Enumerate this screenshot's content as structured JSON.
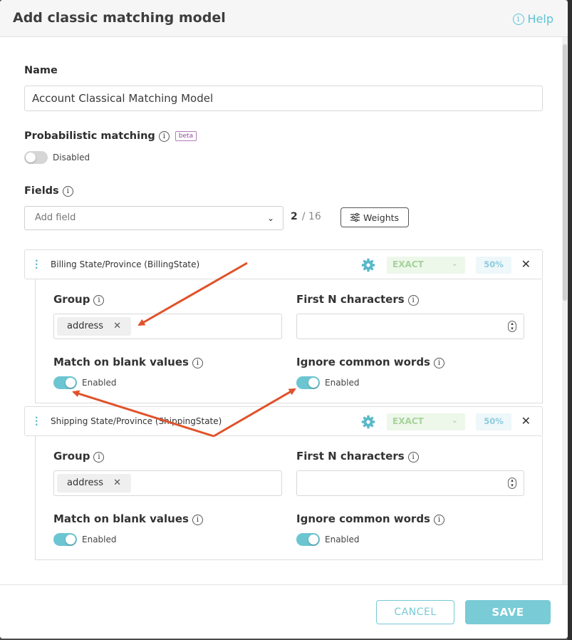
{
  "header": {
    "title": "Add classic matching model",
    "help_label": "Help"
  },
  "name": {
    "label": "Name",
    "value": "Account Classical Matching Model"
  },
  "probabilistic": {
    "label": "Probabilistic matching",
    "badge": "beta",
    "toggle_label": "Disabled",
    "enabled": false
  },
  "fields": {
    "label": "Fields",
    "add_placeholder": "Add field",
    "count": "2",
    "max": "/ 16",
    "weights_label": "Weights",
    "items": [
      {
        "name": "Billing State/Province (BillingState)",
        "match_type": "EXACT",
        "weight": "50%",
        "group_label": "Group",
        "group_chip": "address",
        "first_n_label": "First N characters",
        "blank_label": "Match on blank values",
        "blank_toggle": "Enabled",
        "ignore_label": "Ignore common words",
        "ignore_toggle": "Enabled"
      },
      {
        "name": "Shipping State/Province (ShippingState)",
        "match_type": "EXACT",
        "weight": "50%",
        "group_label": "Group",
        "group_chip": "address",
        "first_n_label": "First N characters",
        "blank_label": "Match on blank values",
        "blank_toggle": "Enabled",
        "ignore_label": "Ignore common words",
        "ignore_toggle": "Enabled"
      }
    ]
  },
  "footer": {
    "cancel_label": "CANCEL",
    "save_label": "SAVE"
  },
  "colors": {
    "accent": "#6cc6d2",
    "arrow": "#e0522a",
    "match_bg": "#edf7ea"
  }
}
